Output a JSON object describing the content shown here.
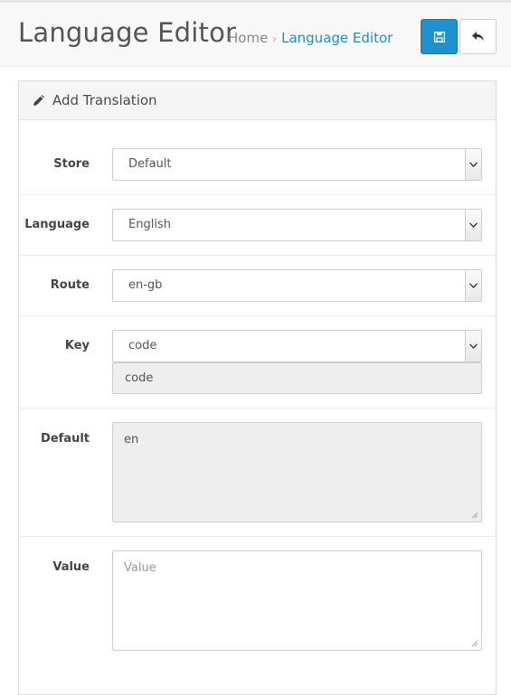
{
  "header": {
    "title": "Language Editor",
    "breadcrumb": [
      "Home",
      "Language Editor"
    ],
    "breadcrumb_separator": "›",
    "save_icon": "floppy-disk-icon",
    "back_icon": "reply-arrow-icon"
  },
  "panel": {
    "title": "Add Translation",
    "icon": "pencil-icon"
  },
  "form": {
    "store": {
      "label": "Store",
      "value": "Default"
    },
    "language": {
      "label": "Language",
      "value": "English"
    },
    "route": {
      "label": "Route",
      "value": "en-gb"
    },
    "key": {
      "label": "Key",
      "value": "code",
      "suggestion": "code"
    },
    "default": {
      "label": "Default",
      "value": "en"
    },
    "value": {
      "label": "Value",
      "placeholder": "Value",
      "value": ""
    }
  },
  "colors": {
    "primary": "#1e91cf",
    "link": "#1f8ec8"
  }
}
